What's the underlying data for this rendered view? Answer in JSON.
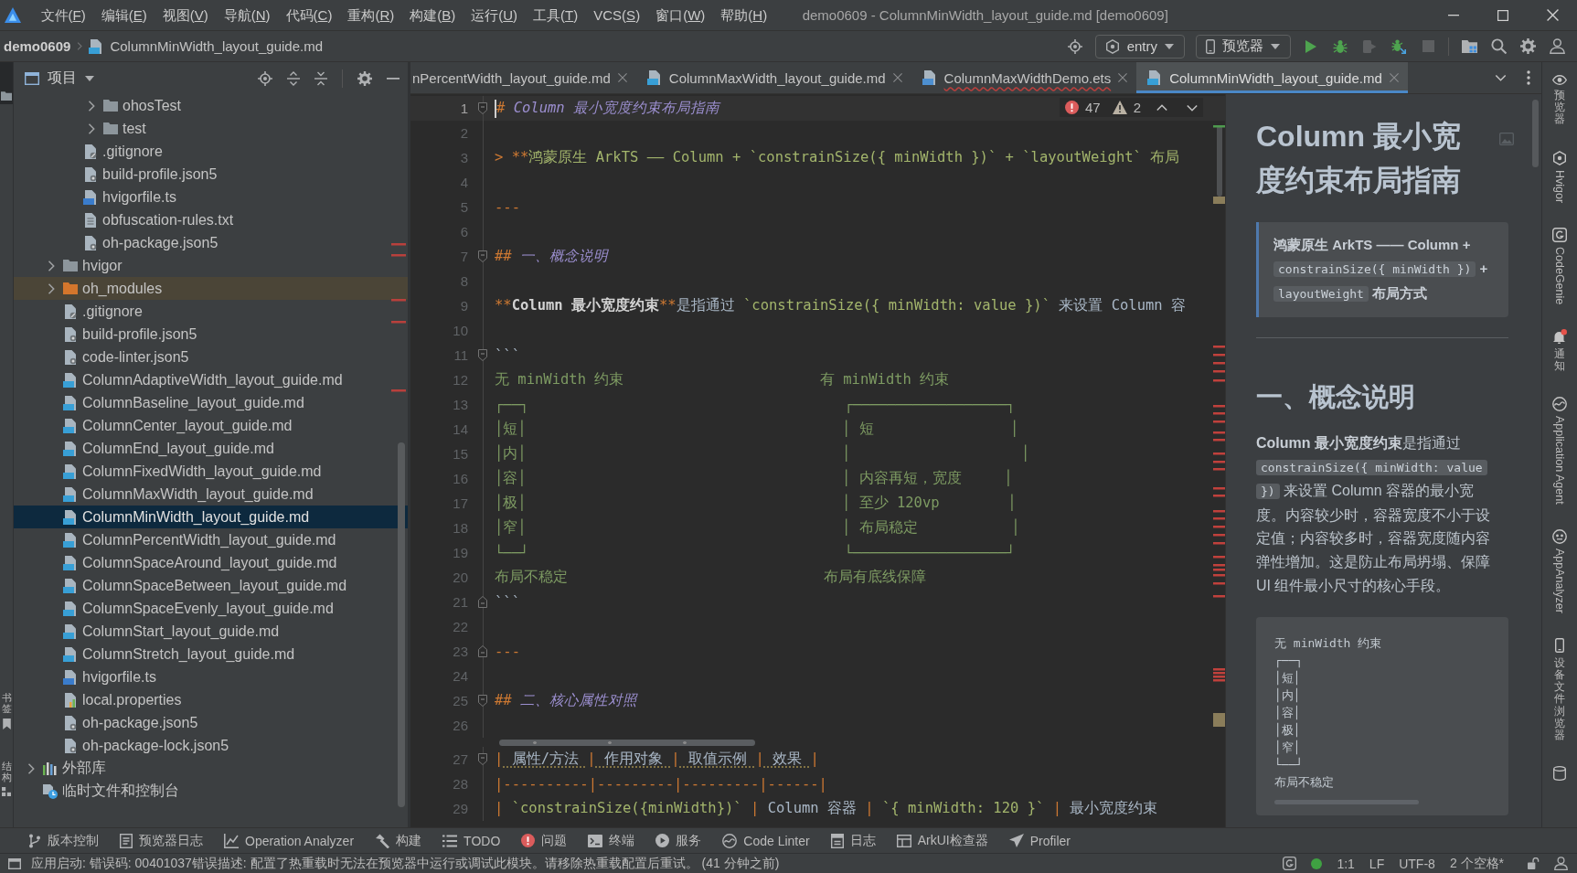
{
  "window": {
    "title": "demo0609 - ColumnMinWidth_layout_guide.md [demo0609]",
    "menu": [
      "文件(F)",
      "编辑(E)",
      "视图(V)",
      "导航(N)",
      "代码(C)",
      "重构(R)",
      "构建(B)",
      "运行(U)",
      "工具(T)",
      "VCS(S)",
      "窗口(W)",
      "帮助(H)"
    ]
  },
  "nav": {
    "breadcrumb": [
      {
        "label": "demo0609",
        "kind": "project"
      },
      {
        "label": "ColumnMinWidth_layout_guide.md",
        "kind": "md"
      }
    ],
    "run_config": "entry",
    "device": "预览器",
    "actions": [
      {
        "kind": "run",
        "disabled": false
      },
      {
        "kind": "debug",
        "disabled": false
      },
      {
        "kind": "attach",
        "disabled": true
      },
      {
        "kind": "profile",
        "disabled": false
      },
      {
        "kind": "stop",
        "disabled": true
      }
    ]
  },
  "left_strip": {
    "top": [
      {
        "kind": "project",
        "selected": true
      }
    ],
    "bottom": [
      {
        "label": "书签",
        "kind": "bookmarks",
        "selected": false
      },
      {
        "label": "结构",
        "kind": "structure",
        "selected": false
      }
    ]
  },
  "project": {
    "title": "项目",
    "tree": [
      {
        "children": [
          {
            "children": [
              {
                "children": [
                  {
                    "label": "ohosTest",
                    "kind": "folder",
                    "expanded": false,
                    "selected": false
                  },
                  {
                    "label": "test",
                    "kind": "folder",
                    "expanded": false,
                    "selected": false
                  }
                ]
              },
              {
                "label": ".gitignore",
                "kind": "ignore",
                "selected": false
              },
              {
                "label": "build-profile.json5",
                "kind": "json",
                "selected": false
              },
              {
                "label": "hvigorfile.ts",
                "kind": "ts",
                "selected": false
              },
              {
                "label": "obfuscation-rules.txt",
                "kind": "text",
                "selected": false
              },
              {
                "label": "oh-package.json5",
                "kind": "json",
                "selected": false
              }
            ]
          },
          {
            "label": "hvigor",
            "kind": "folder",
            "expanded": false,
            "selected": false
          },
          {
            "label": "oh_modules",
            "kind": "excluded_folder",
            "expanded": false,
            "selected": false
          },
          {
            "label": ".gitignore",
            "kind": "ignore",
            "selected": false
          },
          {
            "label": "build-profile.json5",
            "kind": "json",
            "selected": false
          },
          {
            "label": "code-linter.json5",
            "kind": "json",
            "selected": false
          },
          {
            "label": "ColumnAdaptiveWidth_layout_guide.md",
            "kind": "md",
            "selected": false
          },
          {
            "label": "ColumnBaseline_layout_guide.md",
            "kind": "md",
            "selected": false
          },
          {
            "label": "ColumnCenter_layout_guide.md",
            "kind": "md",
            "selected": false
          },
          {
            "label": "ColumnEnd_layout_guide.md",
            "kind": "md",
            "selected": false
          },
          {
            "label": "ColumnFixedWidth_layout_guide.md",
            "kind": "md",
            "selected": false
          },
          {
            "label": "ColumnMaxWidth_layout_guide.md",
            "kind": "md",
            "selected": false
          },
          {
            "label": "ColumnMinWidth_layout_guide.md",
            "kind": "md",
            "selected": true
          },
          {
            "label": "ColumnPercentWidth_layout_guide.md",
            "kind": "md",
            "selected": false
          },
          {
            "label": "ColumnSpaceAround_layout_guide.md",
            "kind": "md",
            "selected": false
          },
          {
            "label": "ColumnSpaceBetween_layout_guide.md",
            "kind": "md",
            "selected": false
          },
          {
            "label": "ColumnSpaceEvenly_layout_guide.md",
            "kind": "md",
            "selected": false
          },
          {
            "label": "ColumnStart_layout_guide.md",
            "kind": "md",
            "selected": false
          },
          {
            "label": "ColumnStretch_layout_guide.md",
            "kind": "md",
            "selected": false
          },
          {
            "label": "hvigorfile.ts",
            "kind": "ts",
            "selected": false
          },
          {
            "label": "local.properties",
            "kind": "properties",
            "selected": false
          },
          {
            "label": "oh-package.json5",
            "kind": "json",
            "selected": false
          },
          {
            "label": "oh-package-lock.json5",
            "kind": "json",
            "selected": false
          }
        ]
      },
      {
        "label": "外部库",
        "kind": "library",
        "expanded": false,
        "selected": false
      },
      {
        "label": "临时文件和控制台",
        "kind": "scratch",
        "selected": false
      }
    ]
  },
  "editor": {
    "tabs": [
      {
        "label": "nPercentWidth_layout_guide.md",
        "selected": false,
        "error": false
      },
      {
        "label": "ColumnMaxWidth_layout_guide.md",
        "kind": "md",
        "selected": false,
        "error": false
      },
      {
        "label": "ColumnMaxWidthDemo.ets",
        "kind": "ets",
        "selected": false,
        "error": true
      },
      {
        "label": "ColumnMinWidth_layout_guide.md",
        "kind": "md",
        "selected": true,
        "error": false
      }
    ],
    "problems": {
      "errors": "47",
      "warnings": "2"
    },
    "lines": [
      {
        "n": "1",
        "current": true,
        "fold_start": true,
        "text": "# Column 最小宽度约束布局指南"
      },
      {
        "n": "2",
        "current": false
      },
      {
        "n": "3",
        "current": false,
        "text": "> **鸿蒙原生 ArkTS —— Column + `constrainSize({ minWidth })` + `layoutWeight` 布局"
      },
      {
        "n": "4",
        "current": false
      },
      {
        "n": "5",
        "current": false,
        "text": "---"
      },
      {
        "n": "6",
        "current": false
      },
      {
        "n": "7",
        "current": false,
        "fold_start": true,
        "text": "## 一、概念说明"
      },
      {
        "n": "8",
        "current": false
      },
      {
        "n": "9",
        "current": false,
        "text": "**Column 最小宽度约束**是指通过 `constrainSize({ minWidth: value })` 来设置 Column 容"
      },
      {
        "n": "10",
        "current": false
      },
      {
        "n": "11",
        "current": false,
        "fold_start": true,
        "text": "```"
      },
      {
        "n": "12",
        "current": false,
        "text": "无 minWidth 约束                       有 minWidth 约束"
      },
      {
        "n": "13",
        "current": false,
        "text": "┌──┐                                     ┌──────────────────┐"
      },
      {
        "n": "14",
        "current": false,
        "text": "│短│                                     │ 短                │"
      },
      {
        "n": "15",
        "current": false,
        "text": "│内│                                     │                    │"
      },
      {
        "n": "16",
        "current": false,
        "text": "│容│                                     │ 内容再短，宽度     │"
      },
      {
        "n": "17",
        "current": false,
        "text": "│极│                                     │ 至少 120vp        │"
      },
      {
        "n": "18",
        "current": false,
        "text": "│窄│                                     │ 布局稳定           │"
      },
      {
        "n": "19",
        "current": false,
        "text": "└──┘                                     └──────────────────┘"
      },
      {
        "n": "20",
        "current": false,
        "text": "布局不稳定                              布局有底线保障"
      },
      {
        "n": "21",
        "current": false,
        "fold_end": true,
        "text": "```"
      },
      {
        "n": "22",
        "current": false
      },
      {
        "n": "23",
        "current": false,
        "fold_end": true,
        "text": "---"
      },
      {
        "n": "24",
        "current": false
      },
      {
        "n": "25",
        "current": false,
        "fold_start": true,
        "text": "## 二、核心属性对照"
      },
      {
        "n": "26",
        "current": false
      },
      {
        "n": "27",
        "current": false,
        "fold_start": true,
        "text": "| 属性/方法 | 作用对象 | 取值示例 | 效果 |"
      },
      {
        "n": "28",
        "current": false,
        "text": "|----------|---------|---------|------|"
      },
      {
        "n": "29",
        "current": false,
        "text": "| `constrainSize({minWidth})` | Column 容器 | `{ minWidth: 120 }` | 最小宽度约束"
      }
    ]
  },
  "preview": {
    "title": "Column 最小宽度约束布局指南",
    "quote": [
      {
        "kind": "text",
        "text": "鸿蒙原生 ArkTS —— Column +"
      },
      {
        "kind": "code",
        "text": "constrainSize({ minWidth })"
      },
      {
        "kind": "text",
        "text": "+"
      },
      {
        "kind": "code",
        "text": "layoutWeight"
      },
      {
        "kind": "text",
        "text": "布局方式"
      }
    ],
    "section_title": "一、概念说明",
    "paragraph": [
      {
        "kind": "text",
        "text": "**Column 最小宽度约束**是指通过"
      },
      {
        "kind": "code",
        "text": "constrainSize({ minWidth: value })"
      },
      {
        "kind": "text",
        "text": "来设置 Column 容器的最小宽度。内容较少时，容器宽度不小于设定值；内容较多时，容器宽度随内容弹性增加。这是防止布局坍塌、保障 UI 组件最小尺寸的核心手段。"
      }
    ],
    "code_block": [
      "无 minWidth 约束",
      "┌──┐",
      "│短│",
      "│内│",
      "│容│",
      "│极│",
      "│窄│",
      "└──┘",
      "布局不稳定"
    ]
  },
  "right_strip": {
    "items": [
      {
        "label": "预览器",
        "kind": "eye",
        "alert": false
      },
      {
        "label": "Hvigor",
        "kind": "hexagon",
        "alert": false
      },
      {
        "label": "CodeGenie",
        "kind": "ring",
        "alert": false
      },
      {
        "label": "通知",
        "kind": "bell",
        "alert": true
      },
      {
        "label": "Application Agent",
        "kind": "swirl",
        "alert": false
      },
      {
        "label": "AppAnalyzer",
        "kind": "robot",
        "alert": false
      },
      {
        "label": "设备文件浏览器",
        "kind": "phone",
        "alert": false
      }
    ]
  },
  "tool_windows": [
    {
      "label": "版本控制",
      "kind": "vcs"
    },
    {
      "label": "预览器日志",
      "kind": "log"
    },
    {
      "label": "Operation Analyzer",
      "kind": "chart"
    },
    {
      "label": "构建",
      "kind": "build"
    },
    {
      "label": "TODO",
      "kind": "todo"
    },
    {
      "label": "问题",
      "kind": "problems"
    },
    {
      "label": "终端",
      "kind": "terminal"
    },
    {
      "label": "服务",
      "kind": "services"
    },
    {
      "label": "Code Linter",
      "kind": "linter"
    },
    {
      "label": "日志",
      "kind": "logs"
    },
    {
      "label": "ArkUI检查器",
      "kind": "inspector"
    },
    {
      "label": "Profiler",
      "kind": "profiler"
    }
  ],
  "status_bar": {
    "message": "应用启动: 错误码: 00401037错误描述: 配置了热重载时无法在预览器中运行或调试此模块。请移除热重载配置后重试。 (41 分钟之前)",
    "items": [
      "1:1",
      "LF",
      "UTF-8",
      "2 个空格*"
    ]
  }
}
